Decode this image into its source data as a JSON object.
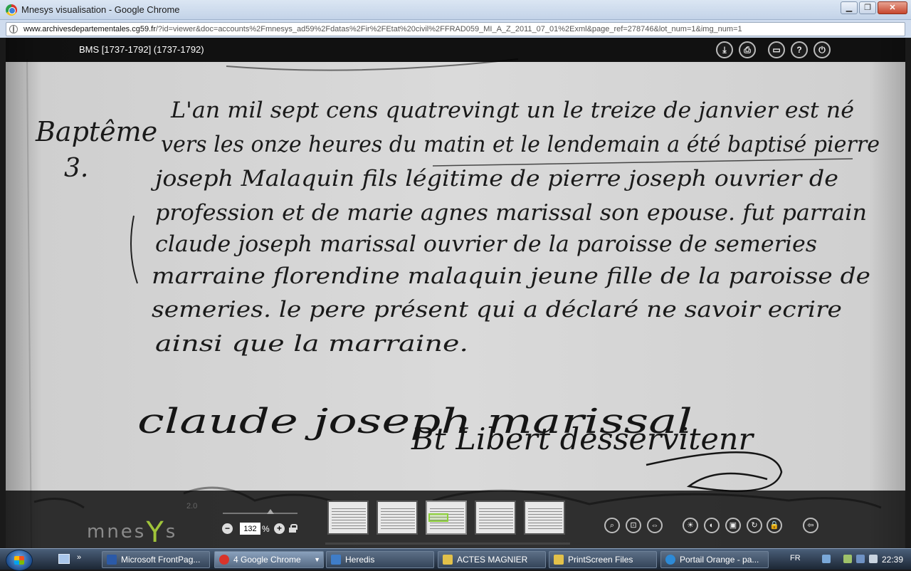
{
  "window": {
    "title": "Mnesys visualisation - Google Chrome",
    "minimize_label": "▁",
    "maximize_label": "❐",
    "close_label": "✕"
  },
  "address_bar": {
    "domain": "www.archivesdepartementales.cg59.fr",
    "path": "/?id=viewer&doc=accounts%2Fmnesys_ad59%2Fdatas%2Fir%2FEtat%20civil%2FFRAD059_MI_A_Z_2011_07_01%2Exml&page_ref=278746&lot_num=1&img_num=1"
  },
  "viewer": {
    "document_title": "BMS [1737-1792] (1737-1792)",
    "header_buttons": [
      {
        "name": "download-icon",
        "glyph": "⤓"
      },
      {
        "name": "print-icon",
        "glyph": "⎙"
      },
      {
        "name": "fullscreen-icon",
        "glyph": "▭"
      },
      {
        "name": "help-icon",
        "glyph": "?"
      },
      {
        "name": "power-icon",
        "glyph": "⏻"
      }
    ],
    "manuscript": {
      "margin_heading": "Baptême",
      "margin_number": "3.",
      "lines": [
        "L'an mil sept cens quatrevingt un le treize de janvier est né",
        "vers les onze heures du matin et le lendemain a été baptisé pierre",
        "joseph Malaquin fils légitime de pierre joseph ouvrier de",
        "profession et de marie agnes marissal son epouse. fut parrain",
        "claude joseph marissal ouvrier de la paroisse de semeries",
        "marraine florendine malaquin jeune fille de la paroisse de",
        "semeries. le pere présent qui a déclaré ne savoir ecrire",
        "ainsi que la marraine."
      ],
      "signature_1": "claude joseph marissal",
      "signature_2": "Bt Libert desservitenr"
    }
  },
  "footer": {
    "logo_text": "mnes",
    "logo_y": "Y",
    "logo_end": "s",
    "version": "2.0",
    "zoom_minus": "−",
    "zoom_plus": "+",
    "zoom_value": "132",
    "zoom_unit": "%",
    "tool_buttons": [
      {
        "name": "zoom-icon",
        "glyph": "⌕"
      },
      {
        "name": "fit-page-icon",
        "glyph": "⊡"
      },
      {
        "name": "fit-width-icon",
        "glyph": "⇔"
      },
      {
        "name": "brightness-icon",
        "glyph": "☀"
      },
      {
        "name": "contrast-icon",
        "glyph": "◐"
      },
      {
        "name": "image-icon",
        "glyph": "▣"
      },
      {
        "name": "rotate-icon",
        "glyph": "↻"
      },
      {
        "name": "lock-icon",
        "glyph": "🔒"
      },
      {
        "name": "collapse-icon",
        "glyph": "⇦"
      }
    ]
  },
  "taskbar": {
    "quick_launch_more": "»",
    "tasks": [
      {
        "label": "Microsoft FrontPag...",
        "color": "#2b5aa8"
      },
      {
        "label": "4 Google Chrome",
        "color": "#d9342b"
      },
      {
        "label": "Heredis",
        "color": "#3f7dc8"
      },
      {
        "label": "ACTES MAGNIER",
        "color": "#e2c14a"
      },
      {
        "label": "PrintScreen Files",
        "color": "#e2c14a"
      },
      {
        "label": "Portail Orange - pa...",
        "color": "#2d8ad6"
      }
    ],
    "language": "FR",
    "clock": "22:39"
  }
}
